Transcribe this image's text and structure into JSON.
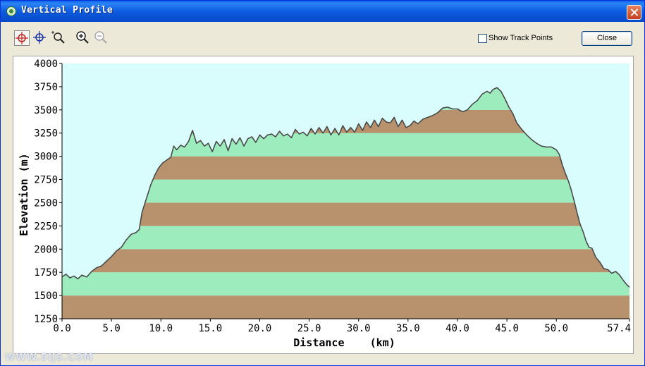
{
  "window": {
    "title": "Vertical Profile"
  },
  "toolbar": {
    "tools": [
      "select-crosshair-icon",
      "pan-crosshair-icon",
      "zoom-box-icon",
      "zoom-in-icon",
      "zoom-out-icon"
    ],
    "show_track_points_label": "Show Track Points",
    "show_track_points_checked": false,
    "close_label": "Close"
  },
  "watermark": "WWW.5IJS.COM",
  "colors": {
    "sky": "#d9fdfd",
    "band_brown": "#b8916d",
    "band_green": "#9cecbd",
    "line": "#4a4a4a",
    "title_blue": "#0a5fe8"
  },
  "chart_data": {
    "type": "area",
    "title": "",
    "xlabel": "Distance    (km)",
    "ylabel": "Elevation (m)",
    "xlim": [
      0,
      57.4
    ],
    "ylim": [
      1250,
      4000
    ],
    "x_ticks": [
      0,
      5,
      10,
      15,
      20,
      25,
      30,
      35,
      40,
      45,
      50,
      57.4
    ],
    "x_tick_labels": [
      "0.0",
      "5.0",
      "10.0",
      "15.0",
      "20.0",
      "25.0",
      "30.0",
      "35.0",
      "40.0",
      "45.0",
      "50.0",
      "57.4"
    ],
    "y_ticks": [
      1250,
      1500,
      1750,
      2000,
      2250,
      2500,
      2750,
      3000,
      3250,
      3500,
      3750,
      4000
    ],
    "y_tick_labels": [
      "1250",
      "1500",
      "1750",
      "2000",
      "2250",
      "2500",
      "2750",
      "3000",
      "3250",
      "3500",
      "3750",
      "4000"
    ],
    "band_height_m": 250,
    "series": [
      {
        "x": [
          0,
          0.4,
          0.8,
          1.2,
          1.6,
          2.0,
          2.5,
          3.0,
          3.5,
          4.0,
          4.5,
          5.0,
          5.5,
          6.0,
          6.5,
          7.0,
          7.5,
          7.8,
          8.1,
          8.4,
          8.7,
          9.0,
          9.4,
          9.8,
          10.2,
          10.6,
          11.0,
          11.3,
          11.6,
          12.0,
          12.4,
          12.8,
          13.2,
          13.6,
          14.0,
          14.4,
          14.8,
          15.2,
          15.6,
          16.0,
          16.4,
          16.8,
          17.2,
          17.6,
          18.0,
          18.4,
          18.8,
          19.2,
          19.6,
          20.0,
          20.4,
          20.8,
          21.2,
          21.6,
          22.0,
          22.4,
          22.8,
          23.2,
          23.6,
          24.0,
          24.4,
          24.8,
          25.2,
          25.6,
          26.0,
          26.4,
          26.8,
          27.2,
          27.6,
          28.0,
          28.4,
          28.8,
          29.2,
          29.6,
          30.0,
          30.4,
          30.8,
          31.2,
          31.6,
          32.0,
          32.4,
          32.8,
          33.2,
          33.6,
          34.0,
          34.4,
          34.8,
          35.2,
          35.6,
          36.0,
          36.5,
          37.0,
          37.5,
          38.0,
          38.5,
          39.0,
          39.5,
          40.0,
          40.5,
          41.0,
          41.5,
          42.0,
          42.5,
          43.0,
          43.3,
          43.6,
          44.0,
          44.4,
          44.8,
          45.2,
          45.6,
          46.0,
          46.5,
          47.0,
          47.5,
          48.0,
          48.5,
          49.0,
          49.5,
          50.0,
          50.3,
          50.6,
          50.9,
          51.2,
          51.5,
          51.8,
          52.1,
          52.4,
          52.7,
          53.0,
          53.3,
          53.6,
          54.0,
          54.4,
          54.8,
          55.2,
          55.6,
          56.0,
          56.4,
          56.8,
          57.1,
          57.4
        ],
        "y": [
          1700,
          1730,
          1690,
          1710,
          1680,
          1720,
          1700,
          1760,
          1800,
          1820,
          1870,
          1920,
          1980,
          2020,
          2100,
          2160,
          2180,
          2210,
          2400,
          2500,
          2600,
          2700,
          2800,
          2880,
          2930,
          2960,
          2990,
          3110,
          3070,
          3120,
          3100,
          3160,
          3280,
          3140,
          3170,
          3110,
          3140,
          3050,
          3160,
          3110,
          3180,
          3060,
          3190,
          3130,
          3200,
          3110,
          3190,
          3210,
          3150,
          3230,
          3190,
          3230,
          3240,
          3210,
          3270,
          3220,
          3240,
          3200,
          3290,
          3240,
          3260,
          3220,
          3300,
          3240,
          3310,
          3250,
          3320,
          3230,
          3300,
          3230,
          3330,
          3260,
          3310,
          3260,
          3350,
          3280,
          3370,
          3310,
          3390,
          3320,
          3410,
          3370,
          3360,
          3420,
          3320,
          3390,
          3310,
          3330,
          3380,
          3350,
          3400,
          3420,
          3440,
          3470,
          3520,
          3530,
          3510,
          3510,
          3480,
          3500,
          3560,
          3600,
          3670,
          3700,
          3680,
          3720,
          3740,
          3700,
          3620,
          3530,
          3460,
          3360,
          3290,
          3230,
          3180,
          3140,
          3110,
          3100,
          3100,
          3070,
          3020,
          2910,
          2820,
          2740,
          2640,
          2520,
          2390,
          2270,
          2190,
          2090,
          2020,
          2010,
          1910,
          1860,
          1790,
          1780,
          1740,
          1760,
          1720,
          1660,
          1620,
          1590
        ]
      }
    ]
  }
}
